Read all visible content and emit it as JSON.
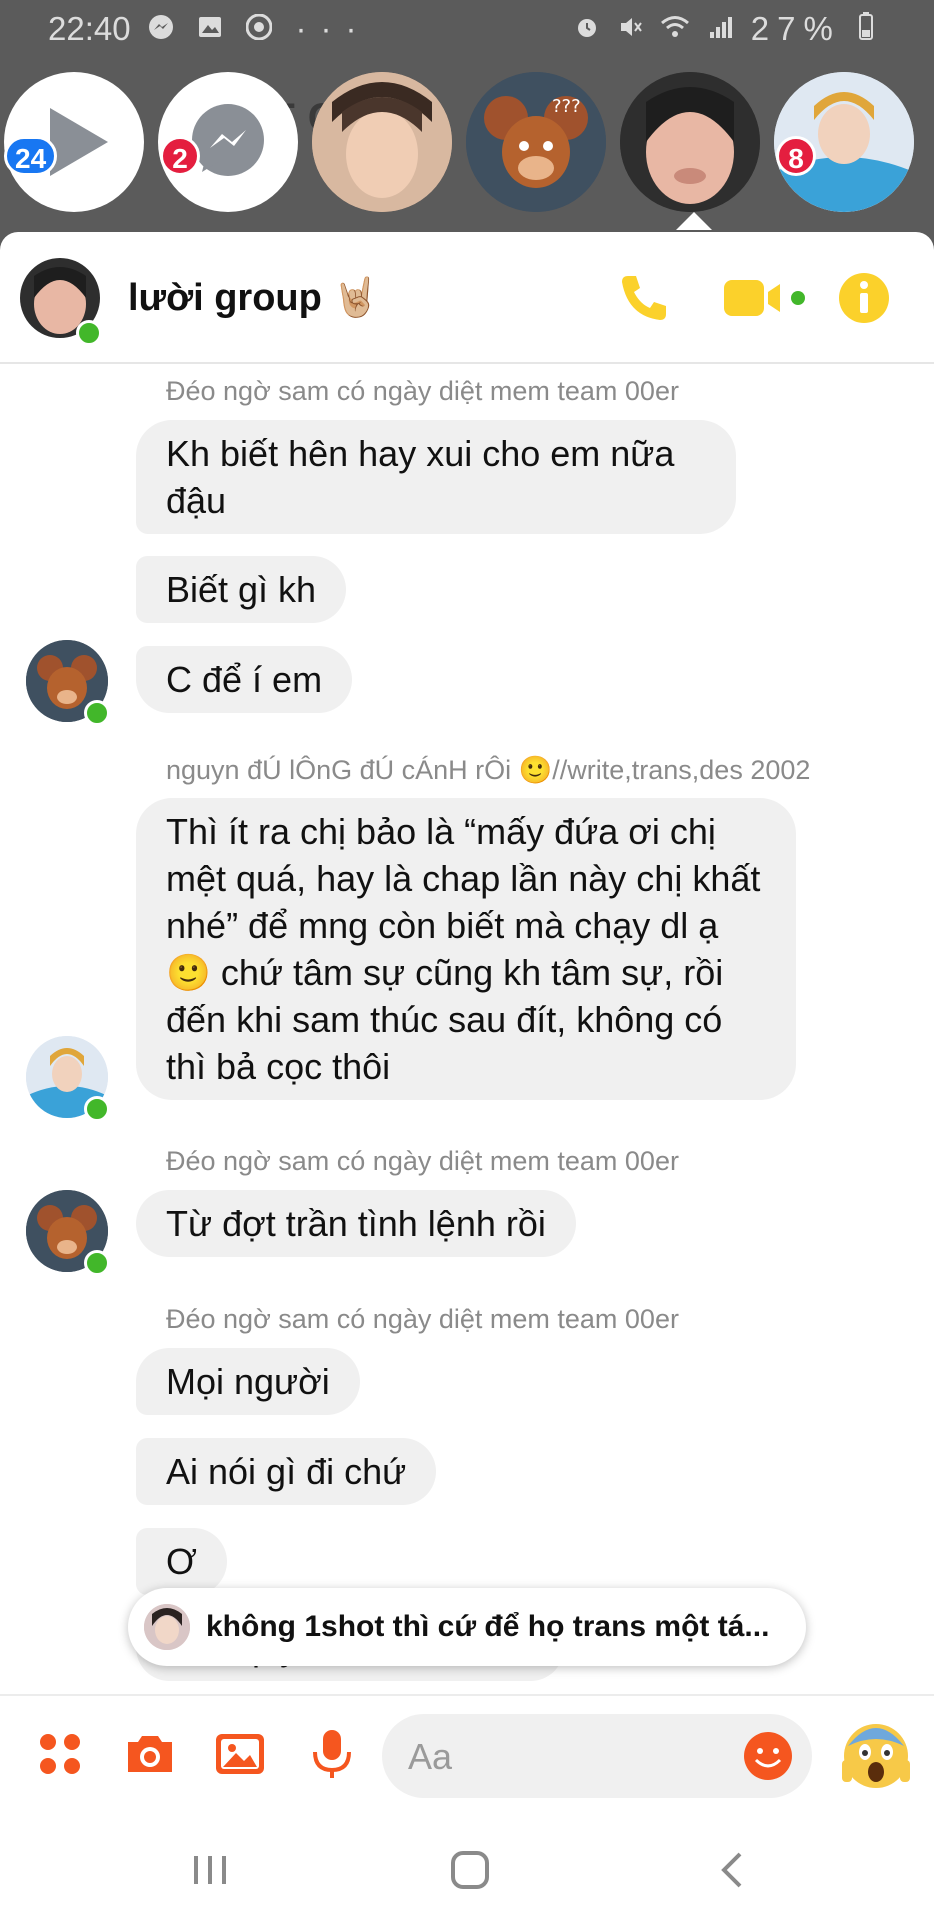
{
  "status_bar": {
    "time": "22:40",
    "left_icons": [
      "messenger-icon",
      "gallery-icon",
      "chrome-icon",
      "more-dots"
    ],
    "right_icons": [
      "alarm-icon",
      "mute-icon",
      "wifi-icon",
      "signal-icon"
    ],
    "battery": "27%"
  },
  "background_text": "E  CH  I",
  "chat_heads": [
    {
      "type": "video",
      "badge": "24",
      "badge_color": "#1877f2"
    },
    {
      "type": "messenger",
      "badge": "2",
      "badge_color": "#e41e3f"
    },
    {
      "type": "contact",
      "badge": ""
    },
    {
      "type": "contact",
      "badge": ""
    },
    {
      "type": "contact",
      "badge": "",
      "active": true
    },
    {
      "type": "contact",
      "badge": "8",
      "badge_color": "#e41e3f"
    }
  ],
  "header": {
    "title": "lười group 🤘🏼",
    "icons": [
      "phone-icon",
      "video-call-icon",
      "info-icon"
    ],
    "accent": "#fbd12b"
  },
  "messages": {
    "sender_1": "Đéo ngờ sam có ngày diệt mem team 00er",
    "m1": "Kh biết hên hay xui cho em nữa đậu",
    "m2": "Biết gì kh",
    "m3": "C để í em",
    "sender_2": "nguyn đÚ lÔnG đÚ cÁnH rÔi 🙂//write,trans,des 2002",
    "m4": "Thì ít ra chị bảo là “mấy đứa ơi chị mệt quá, hay là chap lần này chị khất nhé” để mng còn biết mà chạy dl ạ 🙂 chứ tâm sự cũng kh tâm sự, rồi đến khi sam thúc sau đít, không có thì bả cọc thôi",
    "sender_3": "Đéo ngờ sam có ngày diệt mem team 00er",
    "m5": "Từ đợt trần tình lệnh rồi",
    "sender_4": "Đéo ngờ sam có ngày diệt mem team 00er",
    "m6": "Mọi người",
    "m7": "Ai nói gì đi chứ",
    "m8": "Ơ",
    "m9": "Giải quyết con cb team"
  },
  "toast": {
    "text": "không 1shot thì cứ để họ trans một tá..."
  },
  "composer": {
    "placeholder": "Aa",
    "icons": [
      "apps-icon",
      "camera-icon",
      "image-icon",
      "mic-icon",
      "emoji-icon"
    ],
    "quick_reaction": "😱",
    "accent": "#f5561f"
  },
  "nav_bar": {
    "icons": [
      "recents-icon",
      "home-icon",
      "back-icon"
    ]
  }
}
